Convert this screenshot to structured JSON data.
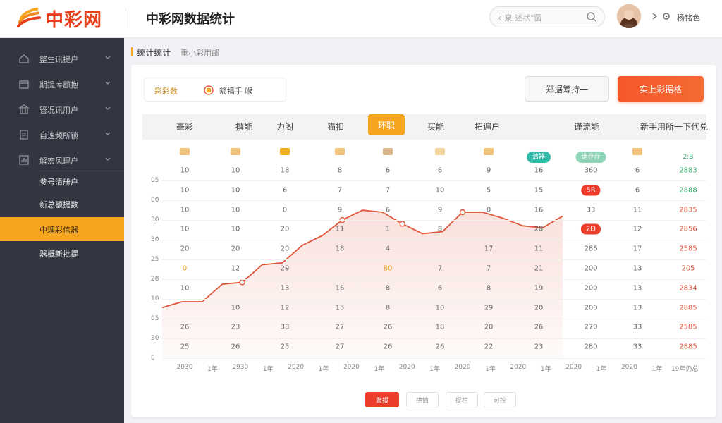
{
  "header": {
    "logo_text": "中彩网",
    "app_title": "中彩网数据统计",
    "search_placeholder": "k!泉  述状\"菌",
    "user_name": "杨铭色",
    "colors": {
      "brand": "#e8401c",
      "accent": "#f6a51f",
      "primary": "#f5572c"
    }
  },
  "sidebar": {
    "items": [
      {
        "label": "整生讯提户",
        "icon": "home-icon"
      },
      {
        "label": "期提库额抱",
        "icon": "store-icon"
      },
      {
        "label": "管况讯用户",
        "icon": "bank-icon"
      },
      {
        "label": "自速频所锁",
        "icon": "doc-icon"
      },
      {
        "label": "解宏风理户",
        "icon": "chart-icon"
      }
    ],
    "subitems": [
      {
        "label": "参号清册户",
        "active": false
      },
      {
        "label": "新总额提数",
        "active": false
      },
      {
        "label": "中理彩信器",
        "active": true
      },
      {
        "label": "器概新批提",
        "active": false
      }
    ]
  },
  "breadcrumb": {
    "main": "统计统计",
    "sub": "重小彩用邮"
  },
  "toolbar": {
    "filter_a": "彩彩数",
    "filter_b": "额播手  喉",
    "ghost_button": "郑据筹持一",
    "primary_button": "实上彩据格"
  },
  "table": {
    "tabs": [
      {
        "label": "毫彩",
        "active": false
      },
      {
        "label": "撰能",
        "active": false
      },
      {
        "label": "力阁",
        "active": false
      },
      {
        "label": "猫扣",
        "active": false
      },
      {
        "label": "环职",
        "active": true
      },
      {
        "label": "买能",
        "active": false
      },
      {
        "label": "拓遍户",
        "active": false
      },
      {
        "label": "谨流能",
        "active": false
      },
      {
        "label": "新手用所一下代兑",
        "active": false
      }
    ],
    "header_icons": [
      {
        "type": "mini",
        "color": "#f0c27a"
      },
      {
        "type": "mini",
        "color": "#f0c27a"
      },
      {
        "type": "mini",
        "color": "#f0b020"
      },
      {
        "type": "mini",
        "color": "#f0c27a"
      },
      {
        "type": "mini",
        "color": "#d9b68a"
      },
      {
        "type": "mini",
        "color": "#f0d39a"
      },
      {
        "type": "mini",
        "color": "#f0c27a"
      },
      {
        "type": "pill",
        "label": "清器",
        "color": "#34b8a8"
      },
      {
        "type": "pill",
        "label": "谐存存",
        "color": "#8fd6b8"
      },
      {
        "type": "mini",
        "color": "#f0c27a"
      },
      {
        "type": "pill",
        "label": "2:B",
        "color": "#ffffff",
        "text": "#35a86b"
      }
    ],
    "yticks": [
      "0",
      "30",
      "05",
      "10",
      "28",
      "25",
      "30",
      "30",
      "00",
      "05"
    ],
    "rows": [
      [
        "10",
        "10",
        "18",
        "8",
        "6",
        "6",
        "9",
        "16",
        "360",
        "6",
        "2883"
      ],
      [
        "10",
        "10",
        "6",
        "7",
        "7",
        "10",
        "5",
        "15",
        "5R",
        "6",
        "2888"
      ],
      [
        "10",
        "10",
        "0",
        "9",
        "6",
        "9",
        "0",
        "16",
        "33",
        "11",
        "2835"
      ],
      [
        "10",
        "10",
        "20",
        "11",
        "1",
        "8",
        "",
        "28",
        "2Ð",
        "12",
        "2856"
      ],
      [
        "20",
        "20",
        "20",
        "18",
        "4",
        "",
        "17",
        "11",
        "286",
        "17",
        "2585"
      ],
      [
        "0",
        "12",
        "29",
        "",
        "80",
        "7",
        "7",
        "21",
        "200",
        "13",
        "205"
      ],
      [
        "10",
        "",
        "13",
        "16",
        "8",
        "6",
        "8",
        "19",
        "200",
        "13",
        "2834"
      ],
      [
        "",
        "10",
        "12",
        "15",
        "8",
        "10",
        "29",
        "20",
        "200",
        "13",
        "2885"
      ],
      [
        "26",
        "23",
        "38",
        "27",
        "26",
        "18",
        "20",
        "26",
        "270",
        "33",
        "2585"
      ],
      [
        "25",
        "26",
        "25",
        "27",
        "26",
        "26",
        "22",
        "23",
        "280",
        "33",
        "2885"
      ]
    ],
    "xticks": [
      "2030",
      "1年",
      "2930",
      "1年",
      "2020",
      "1年",
      "2020",
      "1年",
      "2020",
      "1年",
      "2020",
      "1年",
      "2020",
      "1年",
      "2020",
      "1年",
      "2020",
      "1年",
      "19年仍总"
    ]
  },
  "chart_data": {
    "type": "area",
    "title": "",
    "xlabel": "",
    "ylabel": "",
    "series": [
      {
        "color": "#e0563a",
        "x": [
          0,
          1,
          2,
          3,
          4,
          5,
          6,
          7,
          8,
          9,
          10,
          11,
          12,
          13,
          14,
          15,
          16,
          17,
          18,
          19,
          20
        ],
        "values": [
          2.6,
          2.9,
          2.9,
          3.8,
          3.9,
          4.8,
          4.9,
          5.8,
          6.3,
          7.1,
          7.6,
          7.5,
          6.9,
          6.4,
          6.5,
          7.5,
          7.5,
          7.2,
          6.8,
          6.7,
          7.3
        ]
      }
    ],
    "markers": [
      {
        "x": 4,
        "y": 3.9
      },
      {
        "x": 9,
        "y": 7.1
      },
      {
        "x": 12,
        "y": 6.9
      },
      {
        "x": 15,
        "y": 7.5
      }
    ],
    "ylim": [
      0,
      10
    ]
  },
  "pagination": [
    "聚报",
    "拱情",
    "提栏",
    "可控"
  ]
}
